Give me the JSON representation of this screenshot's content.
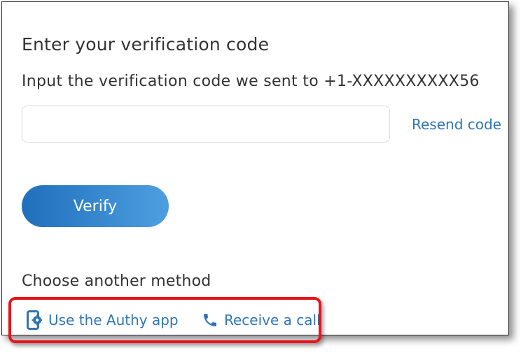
{
  "verification": {
    "title": "Enter your verification code",
    "subtitle": "Input the verification code we sent to +1-XXXXXXXXXX56",
    "code_value": "",
    "code_placeholder": "",
    "resend_label": "Resend code",
    "verify_label": "Verify"
  },
  "methods": {
    "heading": "Choose another method",
    "authy_label": "Use the Authy app",
    "authy_icon": "phone-gear-icon",
    "call_label": "Receive a call",
    "call_icon": "phone-icon"
  },
  "colors": {
    "link": "#2f75b5",
    "button_start": "#1f6fbc",
    "button_end": "#4d9fe0",
    "highlight": "#e8141c",
    "text": "#333333"
  }
}
